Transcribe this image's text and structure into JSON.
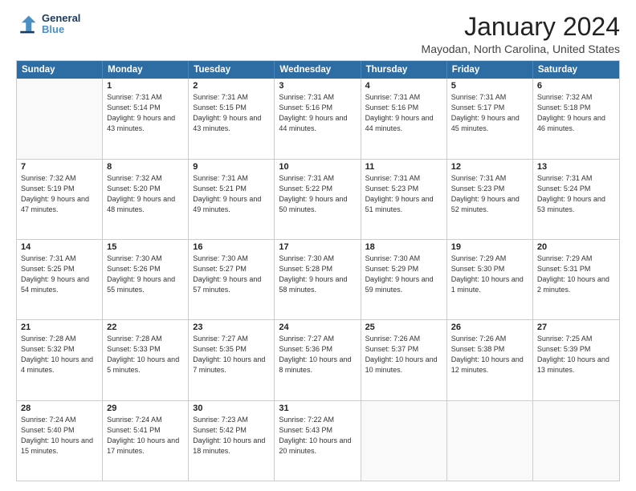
{
  "logo": {
    "line1": "General",
    "line2": "Blue"
  },
  "title": "January 2024",
  "subtitle": "Mayodan, North Carolina, United States",
  "header_days": [
    "Sunday",
    "Monday",
    "Tuesday",
    "Wednesday",
    "Thursday",
    "Friday",
    "Saturday"
  ],
  "weeks": [
    [
      {
        "day": "",
        "sunrise": "",
        "sunset": "",
        "daylight": ""
      },
      {
        "day": "1",
        "sunrise": "7:31 AM",
        "sunset": "5:14 PM",
        "daylight": "9 hours and 43 minutes."
      },
      {
        "day": "2",
        "sunrise": "7:31 AM",
        "sunset": "5:15 PM",
        "daylight": "9 hours and 43 minutes."
      },
      {
        "day": "3",
        "sunrise": "7:31 AM",
        "sunset": "5:16 PM",
        "daylight": "9 hours and 44 minutes."
      },
      {
        "day": "4",
        "sunrise": "7:31 AM",
        "sunset": "5:16 PM",
        "daylight": "9 hours and 44 minutes."
      },
      {
        "day": "5",
        "sunrise": "7:31 AM",
        "sunset": "5:17 PM",
        "daylight": "9 hours and 45 minutes."
      },
      {
        "day": "6",
        "sunrise": "7:32 AM",
        "sunset": "5:18 PM",
        "daylight": "9 hours and 46 minutes."
      }
    ],
    [
      {
        "day": "7",
        "sunrise": "7:32 AM",
        "sunset": "5:19 PM",
        "daylight": "9 hours and 47 minutes."
      },
      {
        "day": "8",
        "sunrise": "7:32 AM",
        "sunset": "5:20 PM",
        "daylight": "9 hours and 48 minutes."
      },
      {
        "day": "9",
        "sunrise": "7:31 AM",
        "sunset": "5:21 PM",
        "daylight": "9 hours and 49 minutes."
      },
      {
        "day": "10",
        "sunrise": "7:31 AM",
        "sunset": "5:22 PM",
        "daylight": "9 hours and 50 minutes."
      },
      {
        "day": "11",
        "sunrise": "7:31 AM",
        "sunset": "5:23 PM",
        "daylight": "9 hours and 51 minutes."
      },
      {
        "day": "12",
        "sunrise": "7:31 AM",
        "sunset": "5:23 PM",
        "daylight": "9 hours and 52 minutes."
      },
      {
        "day": "13",
        "sunrise": "7:31 AM",
        "sunset": "5:24 PM",
        "daylight": "9 hours and 53 minutes."
      }
    ],
    [
      {
        "day": "14",
        "sunrise": "7:31 AM",
        "sunset": "5:25 PM",
        "daylight": "9 hours and 54 minutes."
      },
      {
        "day": "15",
        "sunrise": "7:30 AM",
        "sunset": "5:26 PM",
        "daylight": "9 hours and 55 minutes."
      },
      {
        "day": "16",
        "sunrise": "7:30 AM",
        "sunset": "5:27 PM",
        "daylight": "9 hours and 57 minutes."
      },
      {
        "day": "17",
        "sunrise": "7:30 AM",
        "sunset": "5:28 PM",
        "daylight": "9 hours and 58 minutes."
      },
      {
        "day": "18",
        "sunrise": "7:30 AM",
        "sunset": "5:29 PM",
        "daylight": "9 hours and 59 minutes."
      },
      {
        "day": "19",
        "sunrise": "7:29 AM",
        "sunset": "5:30 PM",
        "daylight": "10 hours and 1 minute."
      },
      {
        "day": "20",
        "sunrise": "7:29 AM",
        "sunset": "5:31 PM",
        "daylight": "10 hours and 2 minutes."
      }
    ],
    [
      {
        "day": "21",
        "sunrise": "7:28 AM",
        "sunset": "5:32 PM",
        "daylight": "10 hours and 4 minutes."
      },
      {
        "day": "22",
        "sunrise": "7:28 AM",
        "sunset": "5:33 PM",
        "daylight": "10 hours and 5 minutes."
      },
      {
        "day": "23",
        "sunrise": "7:27 AM",
        "sunset": "5:35 PM",
        "daylight": "10 hours and 7 minutes."
      },
      {
        "day": "24",
        "sunrise": "7:27 AM",
        "sunset": "5:36 PM",
        "daylight": "10 hours and 8 minutes."
      },
      {
        "day": "25",
        "sunrise": "7:26 AM",
        "sunset": "5:37 PM",
        "daylight": "10 hours and 10 minutes."
      },
      {
        "day": "26",
        "sunrise": "7:26 AM",
        "sunset": "5:38 PM",
        "daylight": "10 hours and 12 minutes."
      },
      {
        "day": "27",
        "sunrise": "7:25 AM",
        "sunset": "5:39 PM",
        "daylight": "10 hours and 13 minutes."
      }
    ],
    [
      {
        "day": "28",
        "sunrise": "7:24 AM",
        "sunset": "5:40 PM",
        "daylight": "10 hours and 15 minutes."
      },
      {
        "day": "29",
        "sunrise": "7:24 AM",
        "sunset": "5:41 PM",
        "daylight": "10 hours and 17 minutes."
      },
      {
        "day": "30",
        "sunrise": "7:23 AM",
        "sunset": "5:42 PM",
        "daylight": "10 hours and 18 minutes."
      },
      {
        "day": "31",
        "sunrise": "7:22 AM",
        "sunset": "5:43 PM",
        "daylight": "10 hours and 20 minutes."
      },
      {
        "day": "",
        "sunrise": "",
        "sunset": "",
        "daylight": ""
      },
      {
        "day": "",
        "sunrise": "",
        "sunset": "",
        "daylight": ""
      },
      {
        "day": "",
        "sunrise": "",
        "sunset": "",
        "daylight": ""
      }
    ]
  ]
}
